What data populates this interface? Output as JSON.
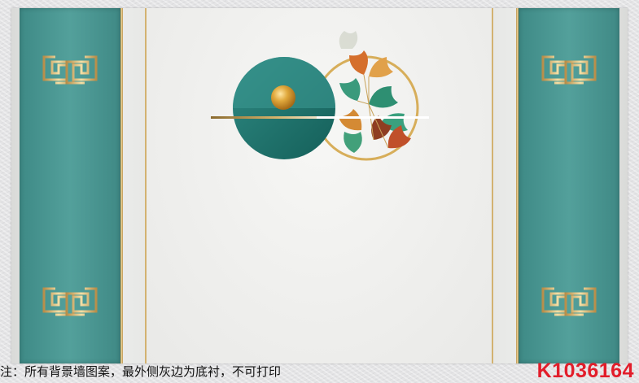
{
  "image": {
    "kind": "background wall decor design",
    "colors": {
      "teal": "#4f9a95",
      "dark_teal": "#1f6e69",
      "gold": "#d4ad63",
      "cream": "#efefef",
      "warning_red": "#e21d2a"
    },
    "motifs": [
      "fret-pattern-panels",
      "teal-half-circle",
      "gold-sphere",
      "gold-ring",
      "ginkgo-leaves",
      "gold-light-beam"
    ]
  },
  "footer": {
    "note": "注：所有背景墙图案，最外侧灰边为底衬，不可打印",
    "product_code": "K1036164"
  }
}
